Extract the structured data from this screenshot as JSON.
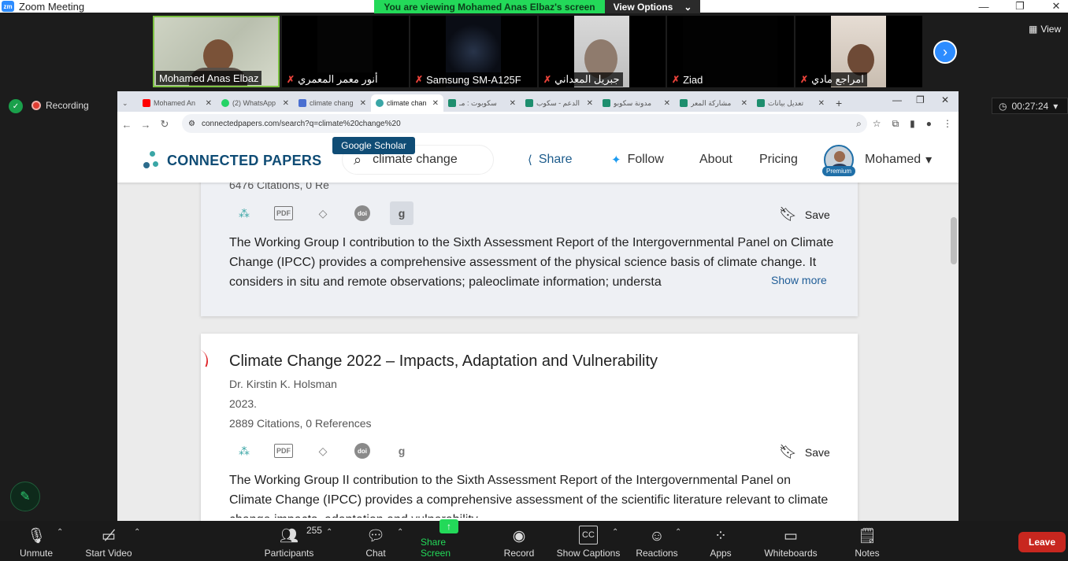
{
  "zoom": {
    "title": "Zoom Meeting",
    "logo": "zm",
    "banner": "You are viewing Mohamed Anas Elbaz's screen",
    "view_options": "View Options",
    "view_label": "View",
    "recording": "Recording",
    "timer": "00:27:24",
    "participants": [
      {
        "name": "Mohamed Anas Elbaz",
        "muted": false
      },
      {
        "name": "أنور معمر المعمري",
        "muted": true
      },
      {
        "name": "Samsung SM-A125F",
        "muted": true
      },
      {
        "name": "جبريل المعداني",
        "muted": true
      },
      {
        "name": "Ziad",
        "muted": true
      },
      {
        "name": "امراجع مادي",
        "muted": true
      }
    ],
    "toolbar": {
      "unmute": "Unmute",
      "start_video": "Start Video",
      "participants": "Participants",
      "participants_count": "255",
      "chat": "Chat",
      "share_screen": "Share Screen",
      "record": "Record",
      "show_captions": "Show Captions",
      "reactions": "Reactions",
      "apps": "Apps",
      "whiteboards": "Whiteboards",
      "notes": "Notes",
      "leave": "Leave"
    }
  },
  "browser": {
    "tabs": [
      {
        "label": "Mohamed An",
        "color": "#ff0000"
      },
      {
        "label": "(2) WhatsApp",
        "color": "#25d366"
      },
      {
        "label": "climate chang",
        "color": "#4a6fd1"
      },
      {
        "label": "climate chan",
        "color": "#3aa6a6",
        "active": true
      },
      {
        "label": "سكوبوت : مـ",
        "color": "#1e8e6e"
      },
      {
        "label": "الدعم - سكوب",
        "color": "#1e8e6e"
      },
      {
        "label": "مدونة سكوبو",
        "color": "#1e8e6e"
      },
      {
        "label": "مشاركة المعر",
        "color": "#1e8e6e"
      },
      {
        "label": "تعديل بيانات",
        "color": "#1e8e6e"
      }
    ],
    "url": "connectedpapers.com/search?q=climate%20change%20"
  },
  "site": {
    "logo_text": "CONNECTED PAPERS",
    "search_value": "climate change",
    "nav": {
      "share": "Share",
      "follow": "Follow",
      "about": "About",
      "pricing": "Pricing"
    },
    "premium": "Premium",
    "user": "Mohamed",
    "tooltip": "Google Scholar",
    "save": "Save",
    "show_more": "Show more",
    "papers": [
      {
        "title": "",
        "meta_partial": "6476 Citations, 0 Re",
        "abstract": "The Working Group I contribution to the Sixth Assessment Report of the Intergovernmental Panel on Climate Change (IPCC) provides a comprehensive assessment of the physical science basis of climate change. It considers in situ and remote observations; paleoclimate information; understa"
      },
      {
        "title": "Climate Change 2022 – Impacts, Adaptation and Vulnerability",
        "author": "Dr. Kirstin K. Holsman",
        "year": "2023.",
        "citations": "2889 Citations, 0 References",
        "abstract": "The Working Group II contribution to the Sixth Assessment Report of the Intergovernmental Panel on Climate Change (IPCC) provides a comprehensive assessment of the scientific literature relevant to climate change impacts, adaptation and vulnerability."
      }
    ]
  },
  "colors": {
    "brand": "#0f4c75",
    "accent": "#3aa6a6",
    "zoom_green": "#23d959",
    "leave_red": "#c8271f"
  }
}
